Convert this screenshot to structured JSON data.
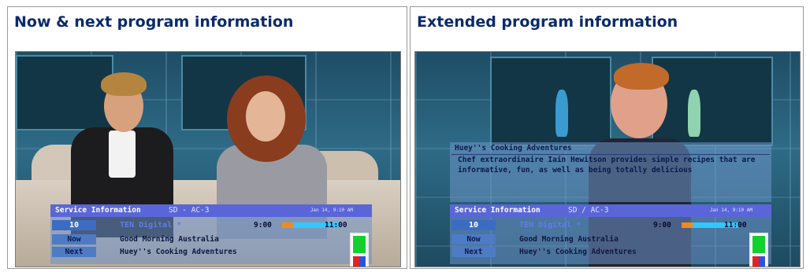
{
  "panels": [
    {
      "title": "Now & next program information",
      "osd": {
        "header": "Service Information",
        "format": "SD - AC-3",
        "datetime": "Jan 14, 9:10 AM",
        "channel_number": "10",
        "channel_name": "TEN Digital *",
        "time_start": "9:00",
        "time_end": "11:00",
        "progress_fraction": 0.2,
        "now_label": "Now",
        "now_program": "Good Morning Australia",
        "next_label": "Next",
        "next_program": "Huey''s Cooking Adventures"
      }
    },
    {
      "title": "Extended program information",
      "epg": {
        "title": "Huey''s Cooking Adventures",
        "description": "Chef extraordinaire Iain Hewitson provides simple recipes that are informative, fun, as well as being totally delicious"
      },
      "osd": {
        "header": "Service Information",
        "format": "SD / AC-3",
        "datetime": "Jan 14, 9:10 AM",
        "channel_number": "10",
        "channel_name": "TEN Digital *",
        "time_start": "9:00",
        "time_end": "11:00",
        "progress_fraction": 0.2,
        "now_label": "Now",
        "now_program": "Good Morning Australia",
        "next_label": "Next",
        "next_program": "Huey''s Cooking Adventures"
      }
    }
  ],
  "colors": {
    "title": "#0b2a6b",
    "osd_header": "#5a66d8",
    "progress_bar": "#33c6ff",
    "progress_fill": "#f08a20"
  }
}
